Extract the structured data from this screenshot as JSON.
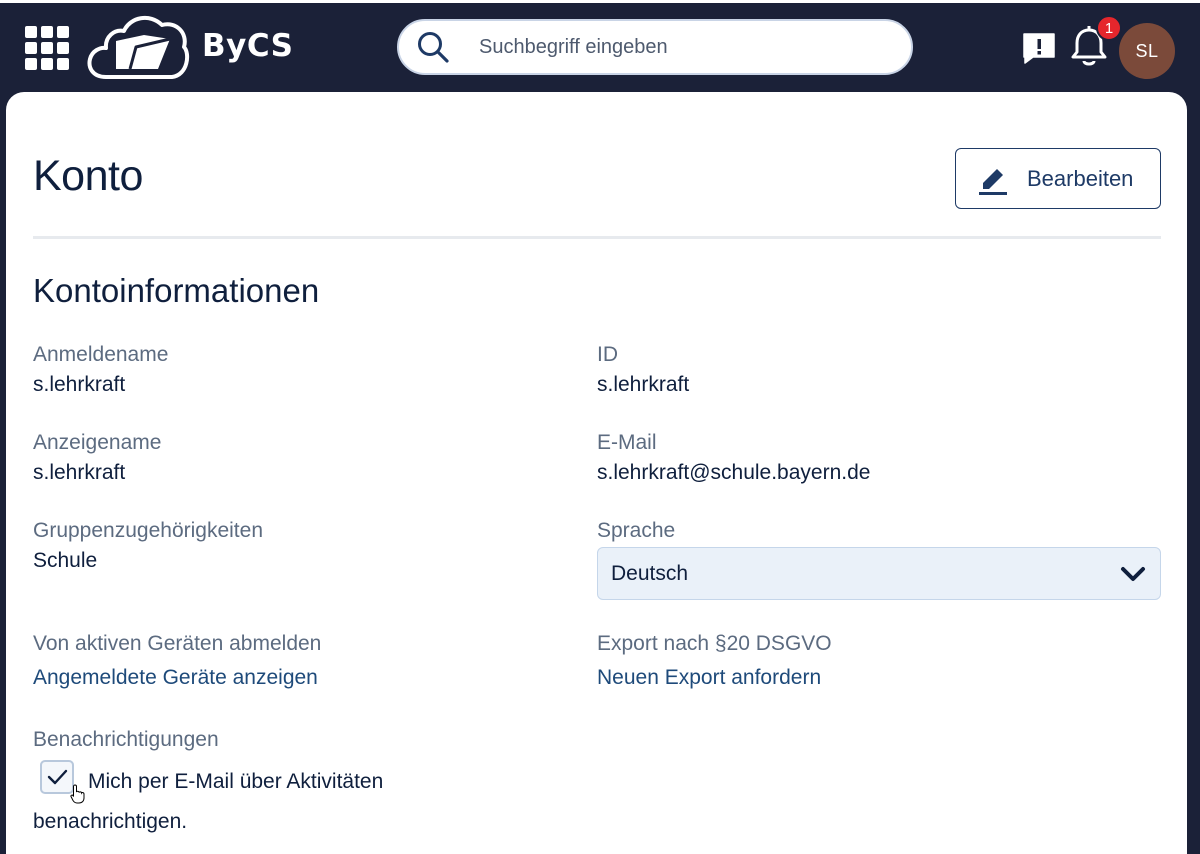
{
  "header": {
    "logo_text": "ByCS",
    "search_placeholder": "Suchbegriff eingeben",
    "notification_count": "1",
    "avatar_initials": "SL"
  },
  "page": {
    "title": "Konto",
    "edit_label": "Bearbeiten",
    "section_title": "Kontoinformationen"
  },
  "fields": {
    "login_name": {
      "label": "Anmeldename",
      "value": "s.lehrkraft"
    },
    "id": {
      "label": "ID",
      "value": "s.lehrkraft"
    },
    "display_name": {
      "label": "Anzeigename",
      "value": "s.lehrkraft"
    },
    "email": {
      "label": "E-Mail",
      "value": "s.lehrkraft@schule.bayern.de"
    },
    "groups": {
      "label": "Gruppenzugehörigkeiten",
      "value": "Schule"
    },
    "language": {
      "label": "Sprache",
      "selected": "Deutsch"
    },
    "devices": {
      "label": "Von aktiven Geräten abmelden",
      "link": "Angemeldete Geräte anzeigen"
    },
    "export": {
      "label": "Export nach §20 DSGVO",
      "link": "Neuen Export anfordern"
    },
    "notifications": {
      "label": "Benachrichtigungen",
      "checkbox_label": "Mich per E-Mail über Aktivitäten benachrichtigen.",
      "checked": true
    }
  },
  "colors": {
    "header_bg": "#1b2138",
    "text_primary": "#0f1f3d",
    "text_secondary": "#5c6b80",
    "link": "#1e4a7a",
    "badge": "#e5262c",
    "avatar_bg": "#7b4a3a"
  },
  "icons": [
    "app-grid-icon",
    "bycs-cloud-logo-icon",
    "search-icon",
    "feedback-icon",
    "bell-icon",
    "pencil-icon",
    "chevron-down-icon",
    "checkmark-icon",
    "hand-cursor-icon"
  ]
}
